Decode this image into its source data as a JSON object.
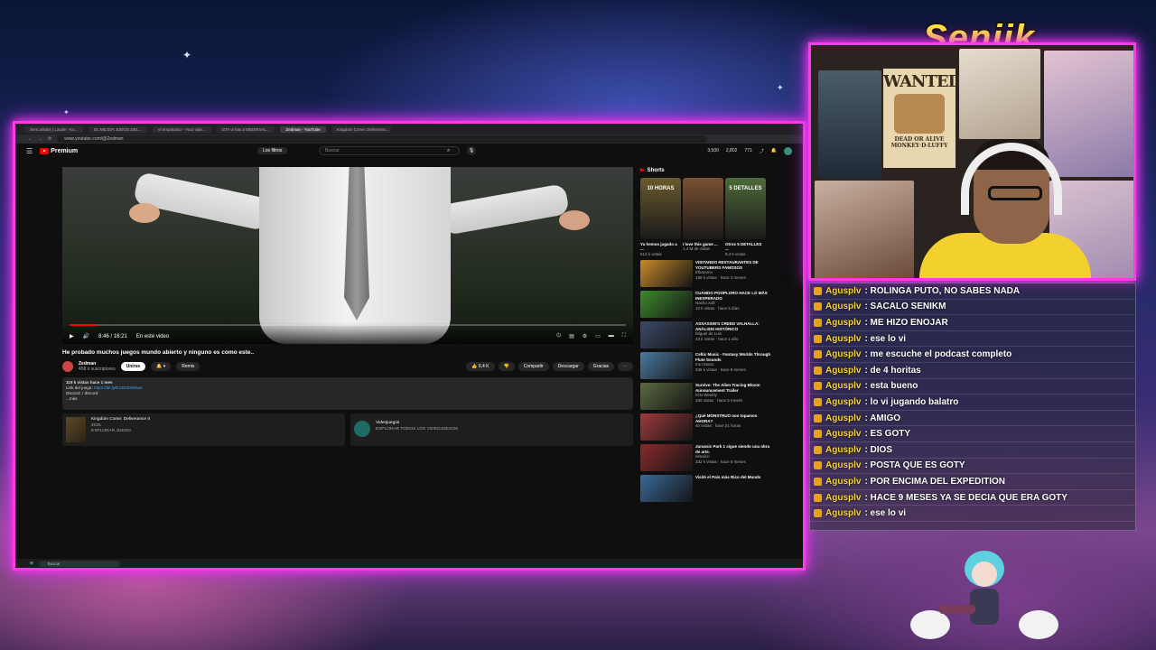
{
  "browser": {
    "tabs": [
      "Sent.ai/tabs | Laude - Ko...",
      "EL MEJOR JUEGO DEL...",
      "el empatador - Your vide...",
      "GTA vi has a MEDIEVAL...",
      "Zedman - YouTube",
      "Kingdom Come: Deliveranc..."
    ],
    "active_tab_index": 4,
    "url": "www.youtube.com/@Zedman"
  },
  "youtube": {
    "logo_text": "Premium",
    "filter_chip": "Los filtros",
    "search_placeholder": "Buscar",
    "header_counts": [
      "3,500",
      "2,802",
      "771"
    ]
  },
  "player": {
    "time": "8:46 / 16:21",
    "chapter": "En este video",
    "progress": 0.05
  },
  "video": {
    "title": "He probado muchos juegos mundo abierto y ninguno es como este..",
    "channel": "Zedman",
    "subscribers": "458 k suscriptores",
    "join_label": "Unirse",
    "remix_label": "Remix",
    "likes": "6,4 K",
    "share_label": "Compartir",
    "download_label": "Descargar",
    "thanks_label": "Gracias"
  },
  "description": {
    "stats": "115 k vistas  hace 1 mes",
    "game_link_label": "Link del juego:",
    "game_link": "https://bit.ly/KCD2Zedman",
    "discord_line": "Discord:  / discord",
    "more": "...más"
  },
  "cards": [
    {
      "title": "Kingdom Come: Deliverance II",
      "year": "2025",
      "cta": "EXPLORAR JUEGO"
    },
    {
      "title": "Videojuegos",
      "year": "",
      "cta": "EXPLORAR TODOS LOS VIDEOJUEGOS"
    }
  ],
  "shorts": {
    "header": "Shorts",
    "items": [
      {
        "title": "Ya hemos jugado a ...",
        "views": "812 k vistas",
        "color": "#6a5a2c",
        "thumb_text": "10 HORAS"
      },
      {
        "title": "I love this game ...",
        "views": "1,4 M de vistas",
        "color": "#7a5130",
        "thumb_text": ""
      },
      {
        "title": "Otros 5 DETALLES ...",
        "views": "9,4 k vistas",
        "color": "#4e6a38",
        "thumb_text": "5 DETALLES"
      }
    ]
  },
  "recommendations": [
    {
      "title": "VISITANDO RESTAURANTES DE YOUTUBERS FAMOSOS",
      "channel": "Elkaramo",
      "meta": "196 k vistas · hace 3 meses",
      "color": "#c88a2a"
    },
    {
      "title": "CUANDO POOPLORO HACE LO MÁS INESPERADO",
      "channel": "Nacho Adil",
      "meta": "10 k vistas · hace 5 días",
      "color": "#3c8a2c"
    },
    {
      "title": "ASSASSIN'S CREED VALHALLA: ANÁLISIS HISTÓRICO",
      "channel": "Miguel de Luis",
      "meta": "33 k vistas · hace 1 año",
      "color": "#3a4a6a"
    },
    {
      "title": "Celtic Music - Fantasy Worlds Through Flute Sounds",
      "channel": "Iron Music",
      "meta": "536 k vistas · hace 8 meses",
      "color": "#4a7aa0"
    },
    {
      "title": "Survive: The Alien Tracing Bloom Announcement Trailer",
      "channel": "IGN Weekly",
      "meta": "330 vistas · hace 5 meses",
      "color": "#5a6a40"
    },
    {
      "title": "¿Qué MONSTRUO nos topamos AHORA?",
      "channel": "",
      "meta": "40 vistas · hace 21 horas",
      "color": "#a03a3a"
    },
    {
      "title": "Jurassic Park 1 sigue siendo una obra de arte.",
      "channel": "elmalcri",
      "meta": "332 k vistas · hace 8 meses",
      "color": "#8a2a2a"
    },
    {
      "title": "Visité el País más Rico del Mundo",
      "channel": "",
      "meta": "",
      "color": "#3a6a9a"
    }
  ],
  "taskbar": {
    "search": "Buscar"
  },
  "streamer": {
    "name": "Seniik"
  },
  "wanted_poster": {
    "title": "WANTED",
    "sub": "DEAD OR ALIVE MONKEY·D·LUFFY"
  },
  "chat": [
    {
      "user": "Agusplv",
      "text": ": ROLINGA PUTO, NO SABES NADA"
    },
    {
      "user": "Agusplv",
      "text": ": SACALO SENIKM"
    },
    {
      "user": "Agusplv",
      "text": ": ME HIZO ENOJAR"
    },
    {
      "user": "Agusplv",
      "text": ": ese lo vi"
    },
    {
      "user": "Agusplv",
      "text": ": me escuche el podcast completo"
    },
    {
      "user": "Agusplv",
      "text": ": de 4 horitas"
    },
    {
      "user": "Agusplv",
      "text": ": esta bueno"
    },
    {
      "user": "Agusplv",
      "text": ": lo vi jugando balatro"
    },
    {
      "user": "Agusplv",
      "text": ": AMIGO"
    },
    {
      "user": "Agusplv",
      "text": ": ES GOTY"
    },
    {
      "user": "Agusplv",
      "text": ": DIOS"
    },
    {
      "user": "Agusplv",
      "text": ": POSTA QUE ES GOTY"
    },
    {
      "user": "Agusplv",
      "text": ": POR ENCIMA DEL EXPEDITION"
    },
    {
      "user": "Agusplv",
      "text": ": HACE 9 MESES YA SE DECIA QUE ERA GOTY"
    },
    {
      "user": "Agusplv",
      "text": ": ese lo vi"
    }
  ]
}
